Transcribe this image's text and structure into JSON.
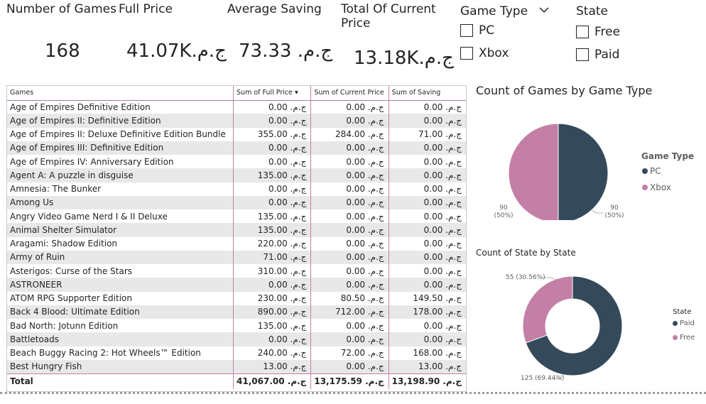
{
  "kpis": {
    "games_count": {
      "title": "Number of Games",
      "value": "168"
    },
    "full_price": {
      "title": "Full Price",
      "value": "41.07K.ج.م"
    },
    "avg_saving": {
      "title": "Average Saving",
      "value": "73.33 .ج.م"
    },
    "current_price": {
      "title": "Total Of Current Price",
      "value": "13.18K.ج.م"
    }
  },
  "slicers": {
    "game_type": {
      "title": "Game Type",
      "options": [
        "PC",
        "Xbox"
      ]
    },
    "state": {
      "title": "State",
      "options": [
        "Free",
        "Paid"
      ]
    }
  },
  "table": {
    "headers": [
      "Games",
      "Sum of Full Price",
      "Sum of Current Price",
      "Sum of Saving"
    ],
    "rows": [
      [
        "Age of Empires Definitive Edition",
        "0.00 .ج.م",
        "0.00 .ج.م",
        "0.00 .ج.م"
      ],
      [
        "Age of Empires II: Definitive Edition",
        "0.00 .ج.م",
        "0.00 .ج.م",
        "0.00 .ج.م"
      ],
      [
        "Age of Empires II: Deluxe Definitive Edition Bundle",
        "355.00 .ج.م",
        "284.00 .ج.م",
        "71.00 .ج.م"
      ],
      [
        "Age of Empires III: Definitive Edition",
        "0.00 .ج.م",
        "0.00 .ج.م",
        "0.00 .ج.م"
      ],
      [
        "Age of Empires IV: Anniversary Edition",
        "0.00 .ج.م",
        "0.00 .ج.م",
        "0.00 .ج.م"
      ],
      [
        "Agent A: A puzzle in disguise",
        "135.00 .ج.م",
        "0.00 .ج.م",
        "0.00 .ج.م"
      ],
      [
        "Amnesia: The Bunker",
        "0.00 .ج.م",
        "0.00 .ج.م",
        "0.00 .ج.م"
      ],
      [
        "Among Us",
        "0.00 .ج.م",
        "0.00 .ج.م",
        "0.00 .ج.م"
      ],
      [
        "Angry Video Game Nerd I & II Deluxe",
        "135.00 .ج.م",
        "0.00 .ج.م",
        "0.00 .ج.م"
      ],
      [
        "Animal Shelter Simulator",
        "135.00 .ج.م",
        "0.00 .ج.م",
        "0.00 .ج.م"
      ],
      [
        "Aragami: Shadow Edition",
        "220.00 .ج.م",
        "0.00 .ج.م",
        "0.00 .ج.م"
      ],
      [
        "Army of Ruin",
        "71.00 .ج.م",
        "0.00 .ج.م",
        "0.00 .ج.م"
      ],
      [
        "Asterigos: Curse of the Stars",
        "310.00 .ج.م",
        "0.00 .ج.م",
        "0.00 .ج.م"
      ],
      [
        "ASTRONEER",
        "0.00 .ج.م",
        "0.00 .ج.م",
        "0.00 .ج.م"
      ],
      [
        "ATOM RPG Supporter Edition",
        "230.00 .ج.م",
        "80.50 .ج.م",
        "149.50 .ج.م"
      ],
      [
        "Back 4 Blood: Ultimate Edition",
        "890.00 .ج.م",
        "712.00 .ج.م",
        "178.00 .ج.م"
      ],
      [
        "Bad North: Jotunn Edition",
        "135.00 .ج.م",
        "0.00 .ج.م",
        "0.00 .ج.م"
      ],
      [
        "Battletoads",
        "0.00 .ج.م",
        "0.00 .ج.م",
        "0.00 .ج.م"
      ],
      [
        "Beach Buggy Racing 2: Hot Wheels™ Edition",
        "240.00 .ج.م",
        "72.00 .ج.م",
        "168.00 .ج.م"
      ],
      [
        "Best Hungry Fish",
        "13.00 .ج.م",
        "0.00 .ج.م",
        "13.00 .ج.م"
      ]
    ],
    "total": [
      "Total",
      "41,067.00 .ج.م",
      "13,175.59 .ج.م",
      "13,198.90 .ج.م"
    ]
  },
  "chart_data": [
    {
      "type": "pie",
      "title": "Count of Games by Game Type",
      "legend_title": "Game Type",
      "legend_position": "right",
      "categories": [
        "PC",
        "Xbox"
      ],
      "values": [
        90,
        90
      ],
      "labels": [
        "90\n(50%)",
        "90\n(50%)"
      ],
      "colors": [
        "#344a5a",
        "#c47fa6"
      ]
    },
    {
      "type": "pie",
      "subtype": "donut",
      "title": "Count of State by State",
      "legend_title": "State",
      "legend_position": "right",
      "categories": [
        "Paid",
        "Free"
      ],
      "values": [
        125,
        55
      ],
      "labels": [
        "125 (69.44%)",
        "55 (30.56%)"
      ],
      "colors": [
        "#344a5a",
        "#c47fa6"
      ]
    }
  ]
}
